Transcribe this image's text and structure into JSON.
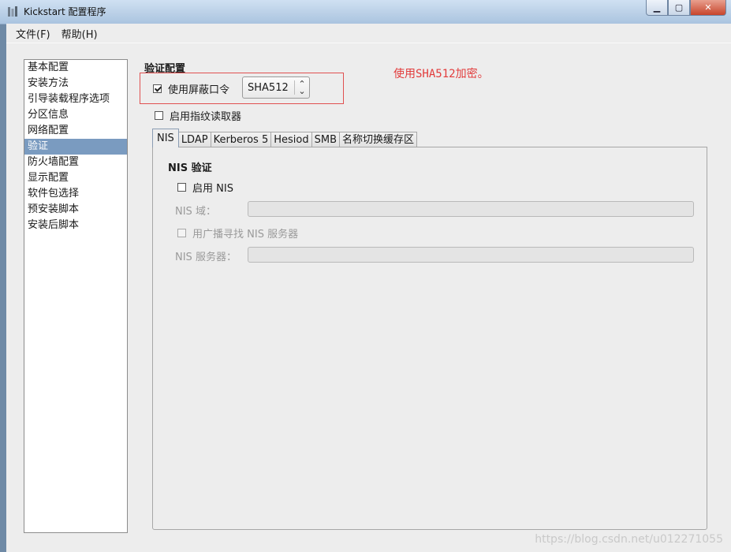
{
  "window": {
    "title": "Kickstart 配置程序",
    "controls": {
      "minimize": "▁",
      "maximize": "▢",
      "close": "✕"
    }
  },
  "menu": [
    "文件(F)",
    "帮助(H)"
  ],
  "sidebar": {
    "items": [
      {
        "label": "基本配置",
        "selected": false
      },
      {
        "label": "安装方法",
        "selected": false
      },
      {
        "label": "引导装载程序选项",
        "selected": false
      },
      {
        "label": "分区信息",
        "selected": false
      },
      {
        "label": "网络配置",
        "selected": false
      },
      {
        "label": "验证",
        "selected": true
      },
      {
        "label": "防火墙配置",
        "selected": false
      },
      {
        "label": "显示配置",
        "selected": false
      },
      {
        "label": "软件包选择",
        "selected": false
      },
      {
        "label": "预安装脚本",
        "selected": false
      },
      {
        "label": "安装后脚本",
        "selected": false
      }
    ]
  },
  "auth": {
    "section_title": "验证配置",
    "shadow_password_label": "使用屏蔽口令",
    "shadow_password_checked": true,
    "hash_algorithm": "SHA512",
    "fingerprint_label": "启用指纹读取器",
    "fingerprint_checked": false
  },
  "annotation": "使用SHA512加密。",
  "tabs": [
    {
      "label": "NIS",
      "active": true
    },
    {
      "label": "LDAP",
      "active": false
    },
    {
      "label": "Kerberos 5",
      "active": false
    },
    {
      "label": "Hesiod",
      "active": false
    },
    {
      "label": "SMB",
      "active": false
    },
    {
      "label": "名称切换缓存区",
      "active": false
    }
  ],
  "nis": {
    "heading": "NIS 验证",
    "enable_label": "启用 NIS",
    "enable_checked": false,
    "domain_label": "NIS 域：",
    "domain_value": "",
    "broadcast_label": "用广播寻找 NIS 服务器",
    "broadcast_checked": false,
    "server_label": "NIS 服务器：",
    "server_value": ""
  },
  "watermark": "https://blog.csdn.net/u012271055",
  "colors": {
    "selection": "#7a9bc0",
    "annotation_red": "#e23b3b"
  }
}
